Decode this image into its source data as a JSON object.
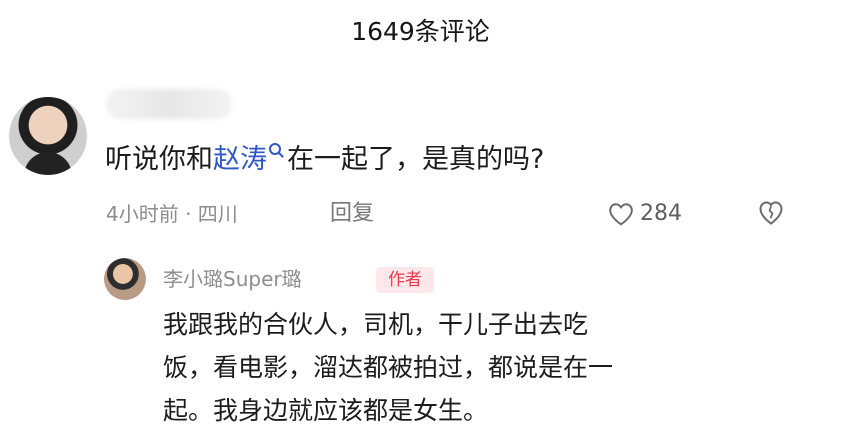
{
  "header": {
    "title": "1649条评论"
  },
  "comment": {
    "text_before": "听说你和",
    "mention": "赵涛",
    "text_after": "在一起了，是真的吗?",
    "meta": "4小时前 · 四川",
    "reply_label": "回复",
    "like_count": "284"
  },
  "reply": {
    "username": "李小璐Super璐",
    "badge": "作者",
    "lines": [
      "我跟我的合伙人，司机，干儿子出去吃",
      "饭，看电影，溜达都被拍过，都说是在一",
      "起。我身边就应该都是女生。"
    ]
  },
  "icons": {
    "search": "search-icon",
    "like": "heart-outline-icon",
    "dislike": "broken-heart-icon"
  },
  "colors": {
    "mention": "#2f57c5",
    "badge_text": "#e53d4f",
    "badge_bg": "#fde7ea"
  }
}
